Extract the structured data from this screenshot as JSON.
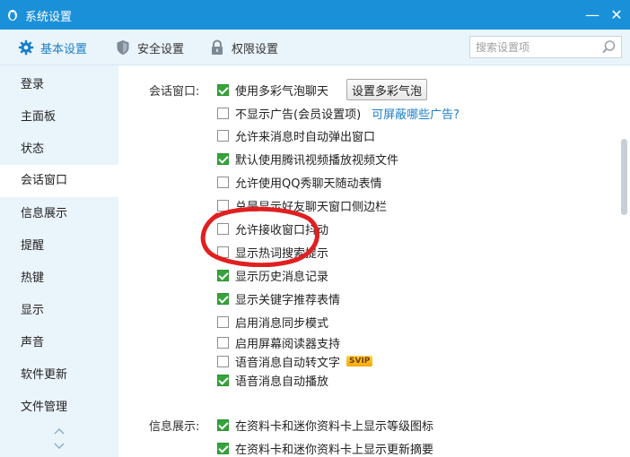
{
  "window": {
    "title": "系统设置",
    "minimize_glyph": "—",
    "close_glyph": "✕"
  },
  "colors": {
    "titlebar": "#1a90d9",
    "accent": "#1a7fc9",
    "checked": "#35a33b",
    "annotation": "#e02020"
  },
  "toolbar": {
    "tabs": [
      {
        "label": "基本设置",
        "icon": "gear-icon",
        "active": true
      },
      {
        "label": "安全设置",
        "icon": "shield-icon",
        "active": false
      },
      {
        "label": "权限设置",
        "icon": "lock-icon",
        "active": false
      }
    ],
    "search": {
      "placeholder": "搜索设置项",
      "value": "",
      "icon": "search-icon"
    }
  },
  "sidebar": {
    "items": [
      {
        "label": "登录",
        "active": false
      },
      {
        "label": "主面板",
        "active": false
      },
      {
        "label": "状态",
        "active": false
      },
      {
        "label": "会话窗口",
        "active": true
      },
      {
        "label": "信息展示",
        "active": false
      },
      {
        "label": "提醒",
        "active": false
      },
      {
        "label": "热键",
        "active": false
      },
      {
        "label": "显示",
        "active": false
      },
      {
        "label": "声音",
        "active": false
      },
      {
        "label": "软件更新",
        "active": false
      },
      {
        "label": "文件管理",
        "active": false
      }
    ]
  },
  "session_window": {
    "label": "会话窗口:",
    "options": [
      {
        "label": "使用多彩气泡聊天",
        "checked": true
      },
      {
        "label": "不显示广告(会员设置项)",
        "checked": false
      },
      {
        "label": "允许来消息时自动弹出窗口",
        "checked": false
      },
      {
        "label": "默认使用腾讯视频播放视频文件",
        "checked": true
      },
      {
        "label": "允许使用QQ秀聊天随动表情",
        "checked": false
      },
      {
        "label": "总是显示好友聊天窗口侧边栏",
        "checked": false
      },
      {
        "label": "允许接收窗口抖动",
        "checked": false
      },
      {
        "label": "显示热词搜索提示",
        "checked": false
      },
      {
        "label": "显示历史消息记录",
        "checked": true
      },
      {
        "label": "显示关键字推荐表情",
        "checked": true
      },
      {
        "label": "启用消息同步模式",
        "checked": false
      },
      {
        "label": "启用屏幕阅读器支持",
        "checked": false
      },
      {
        "label": "语音消息自动转文字",
        "checked": false
      },
      {
        "label": "语音消息自动播放",
        "checked": true
      }
    ],
    "bubble_button": "设置多彩气泡",
    "ad_link": "可屏蔽哪些广告?",
    "svip_badge": "SVIP"
  },
  "info_display": {
    "label": "信息展示:",
    "options": [
      {
        "label": "在资料卡和迷你资料卡上显示等级图标",
        "checked": true
      },
      {
        "label": "在资料卡和迷你资料卡上显示更新摘要",
        "checked": true
      }
    ]
  }
}
